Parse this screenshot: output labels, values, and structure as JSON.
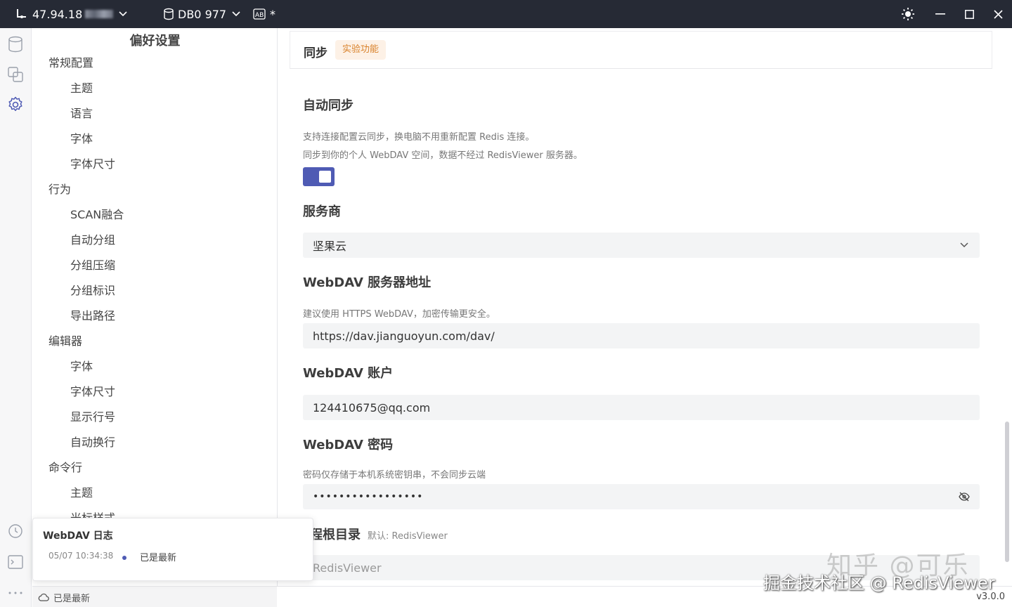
{
  "titlebar": {
    "connection": "47.94.18",
    "db": "DB0 977",
    "format_marker": "*"
  },
  "prefs": {
    "title": "偏好设置",
    "nav": [
      {
        "label": "常规配置",
        "level": 1
      },
      {
        "label": "主题",
        "level": 2
      },
      {
        "label": "语言",
        "level": 2
      },
      {
        "label": "字体",
        "level": 2
      },
      {
        "label": "字体尺寸",
        "level": 2
      },
      {
        "label": "行为",
        "level": 1
      },
      {
        "label": "SCAN融合",
        "level": 2
      },
      {
        "label": "自动分组",
        "level": 2
      },
      {
        "label": "分组压缩",
        "level": 2
      },
      {
        "label": "分组标识",
        "level": 2
      },
      {
        "label": "导出路径",
        "level": 2
      },
      {
        "label": "编辑器",
        "level": 1
      },
      {
        "label": "字体",
        "level": 2
      },
      {
        "label": "字体尺寸",
        "level": 2
      },
      {
        "label": "显示行号",
        "level": 2
      },
      {
        "label": "自动换行",
        "level": 2
      },
      {
        "label": "命令行",
        "level": 1
      },
      {
        "label": "主题",
        "level": 2
      },
      {
        "label": "光标样式",
        "level": 2
      }
    ]
  },
  "sync": {
    "card_title": "同步",
    "badge": "实验功能",
    "auto_title": "自动同步",
    "auto_desc1": "支持连接配置云同步，换电脑不用重新配置 Redis 连接。",
    "auto_desc2": "同步到你的个人 WebDAV 空间，数据不经过 RedisViewer 服务器。",
    "auto_enabled": true,
    "provider_title": "服务商",
    "provider_value": "坚果云",
    "url_title": "WebDAV 服务器地址",
    "url_desc": "建议使用 HTTPS WebDAV，加密传输更安全。",
    "url_value": "https://dav.jianguoyun.com/dav/",
    "account_title": "WebDAV 账户",
    "account_value": "124410675@qq.com",
    "password_title": "WebDAV 密码",
    "password_desc": "密码仅存储于本机系统密钥串，不会同步云端",
    "password_value": "•••••••••••••••••",
    "root_title": "程根目录",
    "root_hint": "默认: RedisViewer",
    "root_placeholder": "RedisViewer"
  },
  "toast": {
    "title": "WebDAV 日志",
    "time": "05/07 10:34:38",
    "message": "已是最新"
  },
  "status": {
    "sync_status": "已是最新",
    "version": "v3.0.0"
  },
  "watermark": {
    "line1": "知乎 @可乐",
    "line2": "掘金技术社区 @ RedisViewer"
  },
  "colors": {
    "titlebar": "#262a35",
    "accent": "#4f5bb4",
    "badge_bg": "#fdf1e6",
    "badge_fg": "#d9822b"
  }
}
